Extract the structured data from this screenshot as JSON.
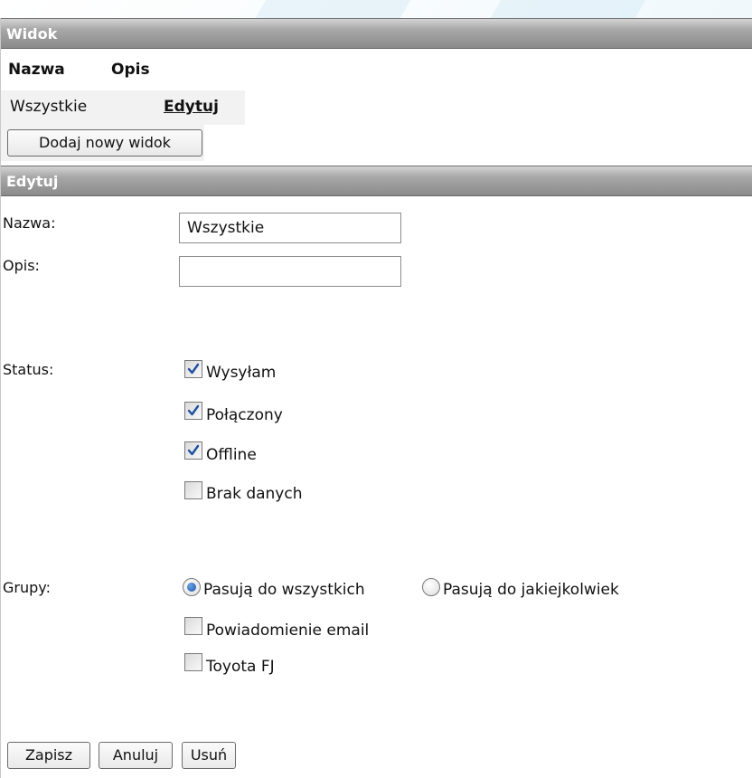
{
  "widok": {
    "title": "Widok",
    "columns": [
      "Nazwa",
      "Opis"
    ],
    "rows": [
      {
        "name": "Wszystkie",
        "action": "Edytuj"
      }
    ],
    "add_button": "Dodaj nowy widok"
  },
  "edytuj": {
    "title": "Edytuj",
    "name_label": "Nazwa:",
    "name_value": "Wszystkie",
    "desc_label": "Opis:",
    "desc_value": "",
    "status_label": "Status:",
    "statuses": [
      {
        "label": "Wysyłam",
        "checked": true
      },
      {
        "label": "Połączony",
        "checked": true
      },
      {
        "label": "Offline",
        "checked": true
      },
      {
        "label": "Brak danych",
        "checked": false
      }
    ],
    "groups_label": "Grupy:",
    "match_options": [
      {
        "label": "Pasują do wszystkich",
        "selected": true
      },
      {
        "label": "Pasują do jakiejkolwiek",
        "selected": false
      }
    ],
    "groups": [
      {
        "label": "Powiadomienie email",
        "checked": false
      },
      {
        "label": "Toyota FJ",
        "checked": false
      }
    ],
    "buttons": {
      "save": "Zapisz",
      "cancel": "Anuluj",
      "delete": "Usuń"
    }
  },
  "colors": {
    "checkmark": "#1f4fa0",
    "radio_selected": "#1d52a8",
    "header": "#8a8a8a"
  }
}
